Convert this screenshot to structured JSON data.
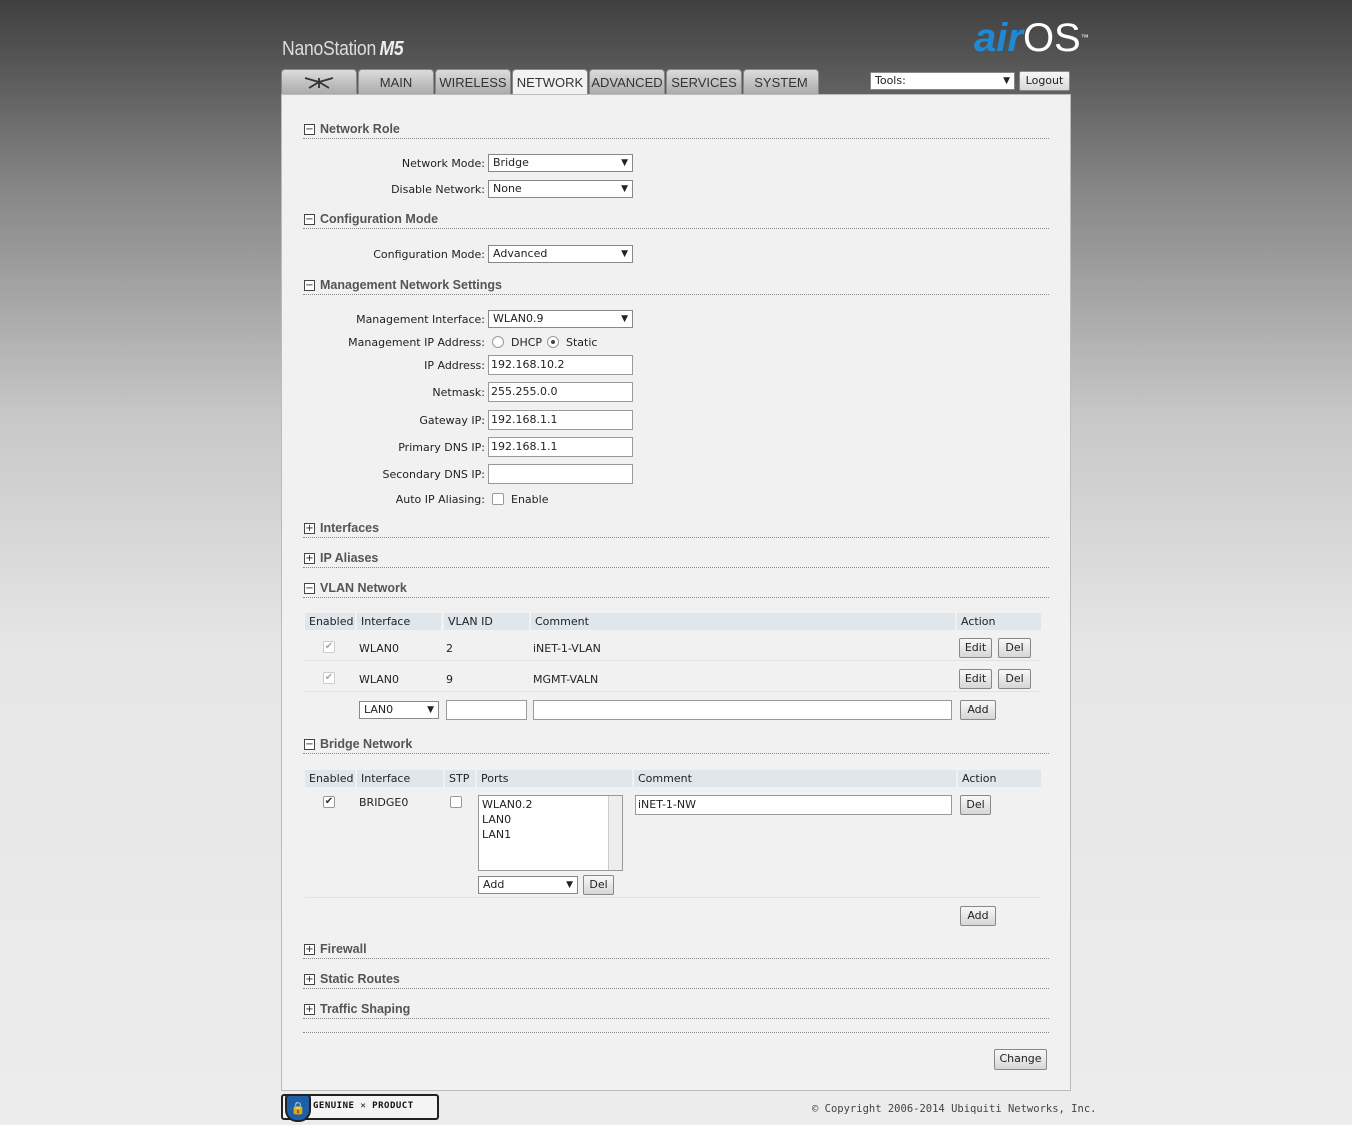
{
  "header": {
    "brand": "NanoStation",
    "brand_model": "M5",
    "logo_air": "air",
    "logo_os": "OS",
    "logo_tm": "™"
  },
  "tabs": [
    {
      "label": "",
      "icon": "ubiquiti-logo-icon"
    },
    {
      "label": "MAIN"
    },
    {
      "label": "WIRELESS"
    },
    {
      "label": "NETWORK",
      "active": true
    },
    {
      "label": "ADVANCED"
    },
    {
      "label": "SERVICES"
    },
    {
      "label": "SYSTEM"
    }
  ],
  "tools": {
    "selected": "Tools:"
  },
  "logout_label": "Logout",
  "sections": {
    "network_role": {
      "title": "Network Role",
      "network_mode_label": "Network Mode:",
      "network_mode_value": "Bridge",
      "disable_network_label": "Disable Network:",
      "disable_network_value": "None"
    },
    "config_mode": {
      "title": "Configuration Mode",
      "label": "Configuration Mode:",
      "value": "Advanced"
    },
    "mgmt": {
      "title": "Management Network Settings",
      "interface_label": "Management Interface:",
      "interface_value": "WLAN0.9",
      "ip_mode_label": "Management IP Address:",
      "dhcp_label": "DHCP",
      "static_label": "Static",
      "selected_mode": "Static",
      "ip_label": "IP Address:",
      "ip_value": "192.168.10.2",
      "netmask_label": "Netmask:",
      "netmask_value": "255.255.0.0",
      "gateway_label": "Gateway IP:",
      "gateway_value": "192.168.1.1",
      "dns1_label": "Primary DNS IP:",
      "dns1_value": "192.168.1.1",
      "dns2_label": "Secondary DNS IP:",
      "dns2_value": "",
      "alias_label": "Auto IP Aliasing:",
      "alias_enable_label": "Enable",
      "alias_enabled": false
    },
    "interfaces": {
      "title": "Interfaces"
    },
    "ip_aliases": {
      "title": "IP Aliases"
    },
    "vlan": {
      "title": "VLAN Network",
      "headers": {
        "enabled": "Enabled",
        "interface": "Interface",
        "vlan_id": "VLAN ID",
        "comment": "Comment",
        "action": "Action"
      },
      "rows": [
        {
          "enabled": true,
          "interface": "WLAN0",
          "vlan_id": "2",
          "comment": "iNET-1-VLAN"
        },
        {
          "enabled": true,
          "interface": "WLAN0",
          "vlan_id": "9",
          "comment": "MGMT-VALN"
        }
      ],
      "new_interface": "LAN0",
      "edit_label": "Edit",
      "del_label": "Del",
      "add_label": "Add"
    },
    "bridge": {
      "title": "Bridge Network",
      "headers": {
        "enabled": "Enabled",
        "interface": "Interface",
        "stp": "STP",
        "ports": "Ports",
        "comment": "Comment",
        "action": "Action"
      },
      "row": {
        "enabled": true,
        "interface": "BRIDGE0",
        "stp": false,
        "ports": [
          "WLAN0.2",
          "LAN0",
          "LAN1"
        ],
        "comment": "iNET-1-NW"
      },
      "port_add_value": "Add",
      "port_del_label": "Del",
      "del_label": "Del",
      "add_label": "Add"
    },
    "firewall": {
      "title": "Firewall"
    },
    "static_routes": {
      "title": "Static Routes"
    },
    "traffic_shaping": {
      "title": "Traffic Shaping"
    }
  },
  "change_label": "Change",
  "footer": {
    "badge_text": "GENUINE ✕ PRODUCT",
    "copyright": "© Copyright 2006-2014 Ubiquiti Networks, Inc."
  }
}
